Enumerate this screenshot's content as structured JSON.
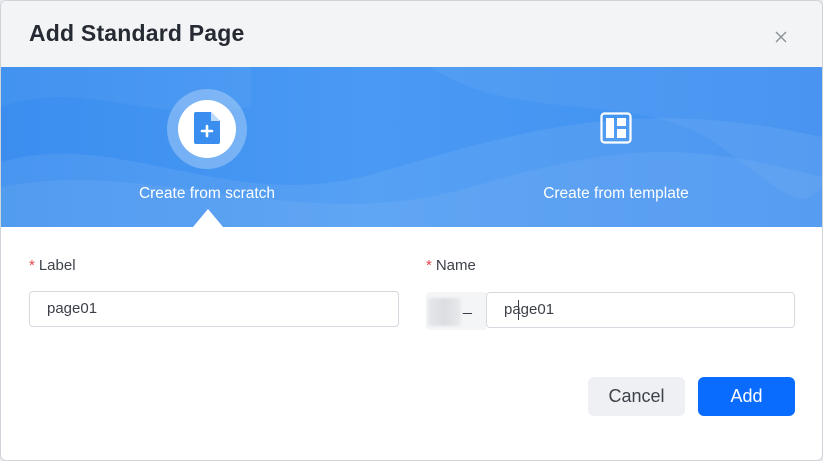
{
  "dialog": {
    "title": "Add Standard Page",
    "close_icon": "close-icon"
  },
  "options": {
    "scratch": {
      "label": "Create from scratch",
      "icon": "new-page-icon",
      "selected": true
    },
    "template": {
      "label": "Create from template",
      "icon": "template-layout-icon",
      "selected": false
    }
  },
  "form": {
    "required_marker": "*",
    "label_field": {
      "label": "Label",
      "value": "page01"
    },
    "name_field": {
      "label": "Name",
      "prefix_separator": "_",
      "value": "page01"
    }
  },
  "buttons": {
    "cancel": "Cancel",
    "add": "Add"
  },
  "colors": {
    "banner": "#3b8eef",
    "primary": "#0a6cff",
    "required": "#e5484d"
  }
}
